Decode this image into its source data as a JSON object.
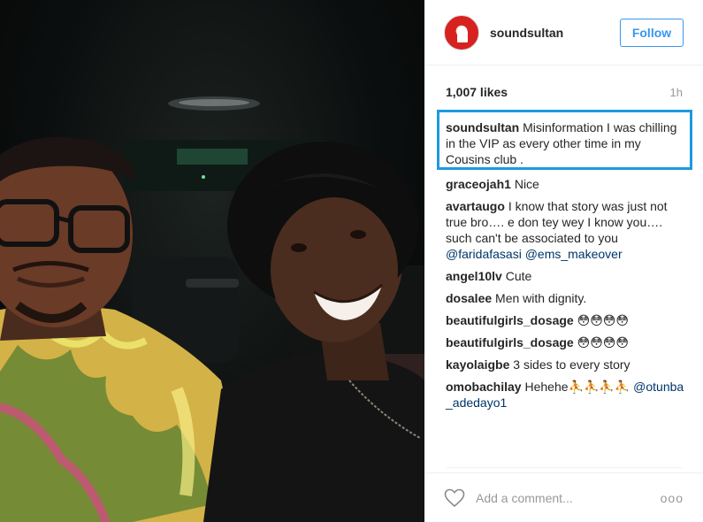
{
  "post": {
    "username": "soundsultan",
    "follow_label": "Follow",
    "likes": "1,007 likes",
    "time": "1h",
    "add_comment_placeholder": "Add a comment...",
    "more_label": "ooo",
    "caption": {
      "user": "soundsultan",
      "text": "Misinformation I was chilling in the VIP as every other time in my Cousins club ."
    },
    "comments": [
      {
        "user": "graceojah1",
        "text": "Nice"
      },
      {
        "user": "avartaugo",
        "text": "I know that story was just not true bro…. e don tey wey I know you…. such can't be associated to you",
        "mentions": "@faridafasasi @ems_makeover"
      },
      {
        "user": "angel10lv",
        "text": "Cute"
      },
      {
        "user": "dosalee",
        "text": "Men with dignity."
      },
      {
        "user": "beautifulgirls_dosage",
        "text": "😳😳😳😳"
      },
      {
        "user": "beautifulgirls_dosage",
        "text": "😳😳😳😳"
      },
      {
        "user": "kayolaigbe",
        "text": "3 sides to every story"
      },
      {
        "user": "omobachilay",
        "text": "Hehehe⛹⛹⛹⛹",
        "mentions": "@otunba_adedayo1"
      }
    ]
  },
  "icons": {
    "heart": "heart-outline-icon",
    "more": "more-options-icon"
  },
  "colors": {
    "follow_blue": "#3897f0",
    "mention_blue": "#003569",
    "highlight_box": "#1d9ae0"
  }
}
